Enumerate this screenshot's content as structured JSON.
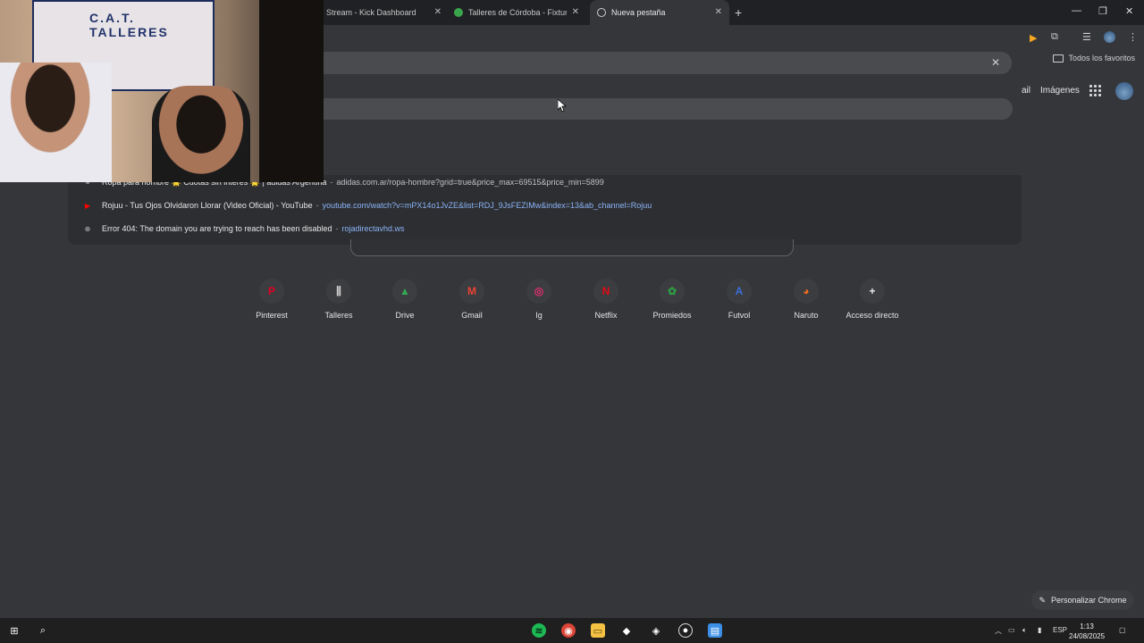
{
  "tabs": [
    {
      "label": "Stream - Kick Dashboard",
      "active": false
    },
    {
      "label": "Talleres de Córdoba - Fixture, T",
      "active": false
    },
    {
      "label": "Nueva pestaña",
      "active": true
    }
  ],
  "bookmarks": {
    "all_label": "Todos los favoritos"
  },
  "google_header": {
    "gmail_partial": "ail",
    "images": "Imágenes"
  },
  "suggestions": [
    {
      "icon": "adidas-icon",
      "title": "Ropa para hombre 🌟 Cuotas sin interés 🌟 | adidas Argentina",
      "url": "adidas.com.ar/ropa-hombre?grid=true&price_max=69515&price_min=5899"
    },
    {
      "icon": "youtube-icon",
      "title": "Rojuu - Tus Ojos Olvidaron Llorar (Video Oficial) - YouTube",
      "url": "youtube.com/watch?v=mPX14o1JvZE&list=RDJ_9JsFEZIMw&index=13&ab_channel=Rojuu"
    },
    {
      "icon": "globe-icon",
      "title": "Error 404: The domain you are trying to reach has been disabled",
      "url": "rojadirectavhd.ws"
    }
  ],
  "shortcuts": [
    {
      "label": "Pinterest",
      "icon": "pinterest-icon",
      "glyph": "P",
      "color": "#e60023"
    },
    {
      "label": "Talleres",
      "icon": "talleres-icon",
      "glyph": "⫼",
      "color": "#d0d0d0"
    },
    {
      "label": "Drive",
      "icon": "drive-icon",
      "glyph": "▲",
      "color": "#34a853"
    },
    {
      "label": "Gmail",
      "icon": "gmail-icon",
      "glyph": "M",
      "color": "#ea4335"
    },
    {
      "label": "Ig",
      "icon": "instagram-icon",
      "glyph": "◎",
      "color": "#e1306c"
    },
    {
      "label": "Netflix",
      "icon": "netflix-icon",
      "glyph": "N",
      "color": "#e50914"
    },
    {
      "label": "Promiedos",
      "icon": "promiedos-icon",
      "glyph": "✿",
      "color": "#2e9e44"
    },
    {
      "label": "Futvol",
      "icon": "futvol-icon",
      "glyph": "A",
      "color": "#3b6ed6"
    },
    {
      "label": "Naruto",
      "icon": "naruto-icon",
      "glyph": "◕",
      "color": "#f06a1f"
    },
    {
      "label": "Acceso directo",
      "icon": "plus-icon",
      "glyph": "+",
      "color": "#e8e8e8"
    }
  ],
  "customize": {
    "label": "Personalizar Chrome"
  },
  "webcam": {
    "flag_text": "C.A.T. TALLERES"
  },
  "taskbar": {
    "language": "ESP",
    "time": "1:13",
    "date": "24/08/2025"
  }
}
